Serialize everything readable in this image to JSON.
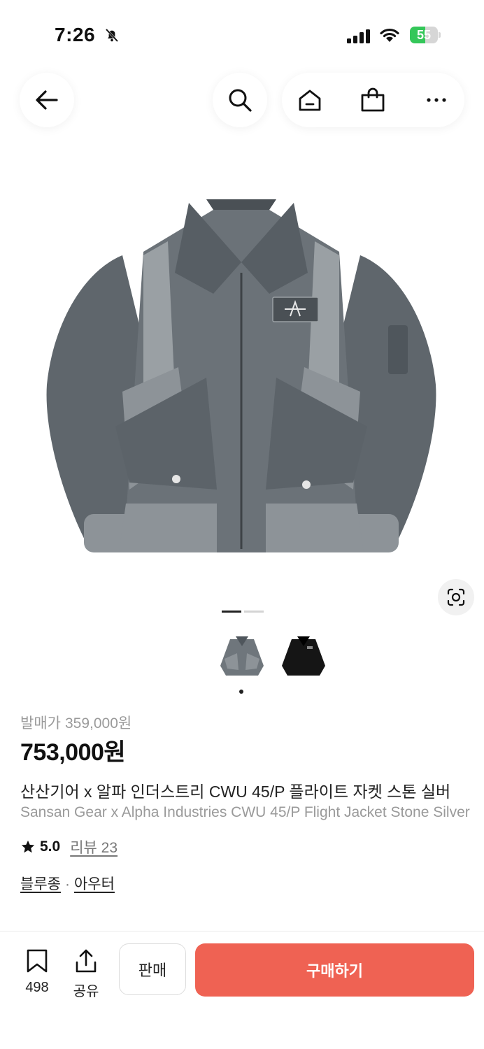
{
  "status_bar": {
    "time": "7:26",
    "battery": "55",
    "battery_level": 0.55
  },
  "header": {
    "back_icon": "arrow-left-icon",
    "search_icon": "search-icon",
    "home_icon": "home-icon",
    "bag_icon": "shopping-bag-icon",
    "more_icon": "more-dots-icon"
  },
  "gallery": {
    "page_index": 1,
    "page_count": 2,
    "thumbnails": [
      {
        "color": "#6f767c",
        "selected": true
      },
      {
        "color": "#151515",
        "selected": false
      }
    ]
  },
  "product": {
    "release_label": "발매가",
    "release_price": "359,000원",
    "price": "753,000원",
    "name_ko": "산산기어 x 알파 인더스트리 CWU 45/P 플라이트 자켓 스톤 실버",
    "name_en": "Sansan Gear x Alpha Industries CWU 45/P Flight Jacket Stone Silver",
    "rating": "5.0",
    "review_label": "리뷰 23",
    "category_1": "블루종",
    "category_sep": "·",
    "category_2": "아우터"
  },
  "bottom_bar": {
    "bookmark_count": "498",
    "share_label": "공유",
    "sell_label": "판매",
    "buy_label": "구매하기"
  },
  "colors": {
    "accent": "#ef6253",
    "muted_text": "#9a9a9a",
    "jacket": "#6f767c"
  }
}
